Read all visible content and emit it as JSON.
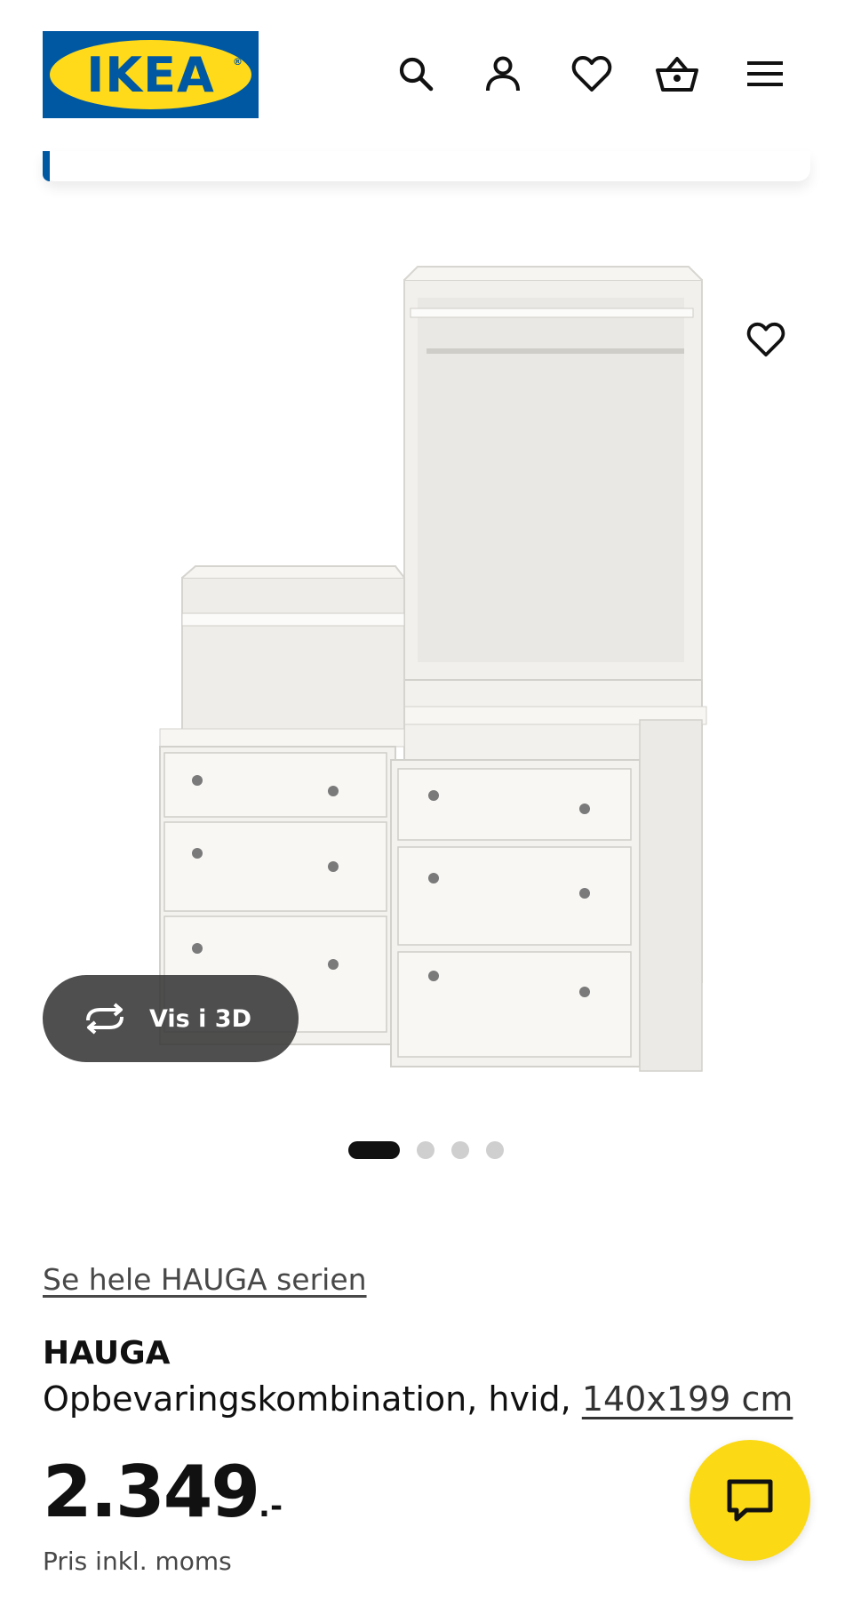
{
  "header": {
    "logo_text": "IKEA",
    "logo_registered": "®",
    "icons": [
      "search-icon",
      "account-icon",
      "heart-icon",
      "basket-icon",
      "menu-icon"
    ]
  },
  "gallery": {
    "view_3d_label": "Vis i 3D",
    "slide_count": 4,
    "active_slide": 1
  },
  "product": {
    "series_link": "Se hele HAUGA serien",
    "name": "HAUGA",
    "description": "Opbevaringskombination, hvid, ",
    "size_link": "140x199 cm",
    "price": "2.349",
    "price_suffix": ".-",
    "price_note": "Pris inkl. moms"
  },
  "colors": {
    "ikea_blue": "#0058a3",
    "ikea_yellow": "#ffda1a",
    "chat_yellow": "#fbd914"
  }
}
